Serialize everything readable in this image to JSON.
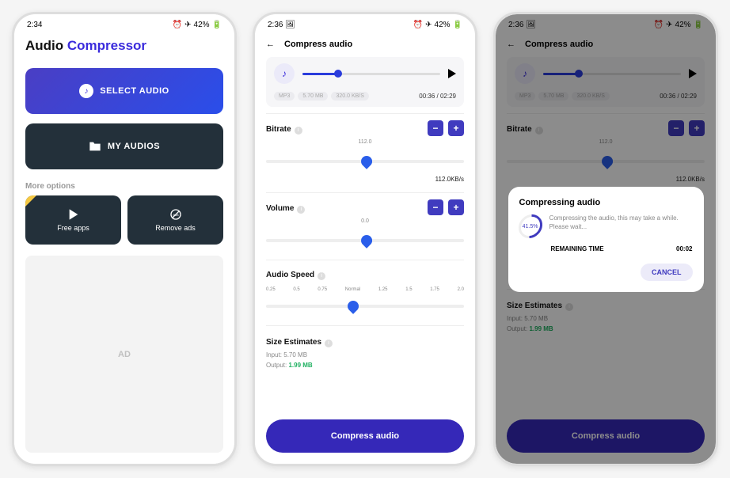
{
  "status": {
    "time1": "2:34",
    "time2": "2:36",
    "time3": "2:36",
    "battery": "42%"
  },
  "screen1": {
    "titleA": "Audio ",
    "titleB": "Compressor",
    "selectBtn": "SELECT AUDIO",
    "myAudiosBtn": "MY AUDIOS",
    "moreLabel": "More options",
    "freeApps": "Free apps",
    "removeAds": "Remove ads",
    "adLabel": "AD"
  },
  "screen2": {
    "header": "Compress audio",
    "badges": [
      "MP3",
      "5.70 MB",
      "320.0 KB/S"
    ],
    "playTime": "00:36 / 02:29",
    "bitrate": {
      "label": "Bitrate",
      "sliderLabel": "112.0",
      "value": "112.0KB/s"
    },
    "volume": {
      "label": "Volume",
      "sliderLabel": "0.0"
    },
    "speed": {
      "label": "Audio Speed",
      "ticks": [
        "0.25",
        "0.5",
        "0.75",
        "Normal",
        "1.25",
        "1.5",
        "1.75",
        "2.0"
      ]
    },
    "estimates": {
      "label": "Size Estimates",
      "input": "Input: 5.70 MB",
      "outputLabel": "Output: ",
      "output": "1.99 MB"
    },
    "compressBtn": "Compress audio"
  },
  "modal": {
    "title": "Compressing audio",
    "progress": "41.5%",
    "msg": "Compressing the audio, this may take a while. Please wait...",
    "remLabel": "REMAINING TIME",
    "remVal": "00:02",
    "cancel": "CANCEL"
  }
}
